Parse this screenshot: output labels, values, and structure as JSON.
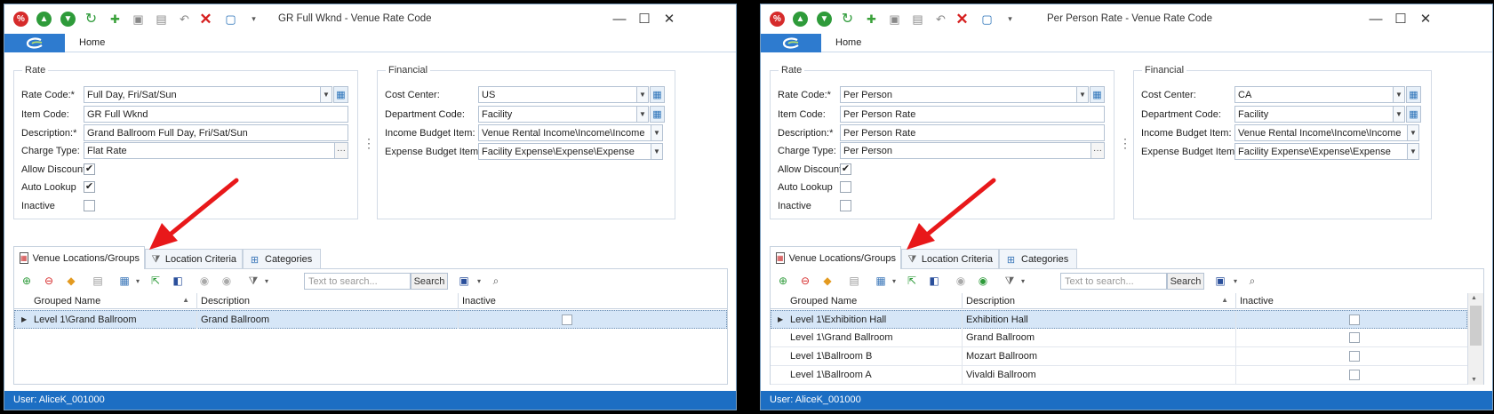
{
  "colors": {
    "accent": "#1c6ec3",
    "arrow": "#e8181a",
    "selected_row": "#d6e6f7"
  },
  "windows": [
    {
      "title": "GR Full Wknd - Venue Rate Code",
      "ribbon": {
        "home_tab": "Home"
      },
      "rate": {
        "group_title": "Rate",
        "rate_code_label": "Rate Code:*",
        "rate_code_value": "Full Day, Fri/Sat/Sun",
        "item_code_label": "Item Code:",
        "item_code_value": "GR Full Wknd",
        "description_label": "Description:*",
        "description_value": "Grand Ballroom Full Day, Fri/Sat/Sun",
        "charge_type_label": "Charge Type:",
        "charge_type_value": "Flat Rate",
        "allow_discount_label": "Allow Discount",
        "allow_discount_mark": "✔",
        "auto_lookup_label": "Auto Lookup",
        "auto_lookup_mark": "✔",
        "inactive_label": "Inactive",
        "inactive_mark": ""
      },
      "financial": {
        "group_title": "Financial",
        "cost_center_label": "Cost Center:",
        "cost_center_value": "US",
        "department_code_label": "Department Code:",
        "department_code_value": "Facility",
        "income_budget_item_label": "Income Budget Item:",
        "income_budget_item_value": "Venue Rental Income\\Income\\Income",
        "expense_budget_item_label": "Expense Budget Item:",
        "expense_budget_item_value": "Facility Expense\\Expense\\Expense"
      },
      "tabs": [
        {
          "label": "Venue Locations/Groups",
          "icon": "venue-icon",
          "active": true
        },
        {
          "label": "Location Criteria",
          "icon": "filter-icon",
          "active": false
        },
        {
          "label": "Categories",
          "icon": "hierarchy-icon",
          "active": false
        }
      ],
      "grid": {
        "search_placeholder": "Text to search...",
        "search_button": "Search",
        "columns": [
          "Grouped Name",
          "Description",
          "Inactive"
        ],
        "rows": [
          {
            "grouped_name": "Level 1\\Grand Ballroom",
            "description": "Grand Ballroom",
            "inactive": false
          }
        ]
      },
      "status": "User: AliceK_001000"
    },
    {
      "title": "Per Person Rate - Venue Rate Code",
      "ribbon": {
        "home_tab": "Home"
      },
      "rate": {
        "group_title": "Rate",
        "rate_code_label": "Rate Code:*",
        "rate_code_value": "Per Person",
        "item_code_label": "Item Code:",
        "item_code_value": "Per Person Rate",
        "description_label": "Description:*",
        "description_value": "Per Person Rate",
        "charge_type_label": "Charge Type:",
        "charge_type_value": "Per Person",
        "allow_discount_label": "Allow Discount",
        "allow_discount_mark": "✔",
        "auto_lookup_label": "Auto Lookup",
        "auto_lookup_mark": "",
        "inactive_label": "Inactive",
        "inactive_mark": ""
      },
      "financial": {
        "group_title": "Financial",
        "cost_center_label": "Cost Center:",
        "cost_center_value": "CA",
        "department_code_label": "Department Code:",
        "department_code_value": "Facility",
        "income_budget_item_label": "Income Budget Item:",
        "income_budget_item_value": "Venue Rental Income\\Income\\Income",
        "expense_budget_item_label": "Expense Budget Item:",
        "expense_budget_item_value": "Facility Expense\\Expense\\Expense"
      },
      "tabs": [
        {
          "label": "Venue Locations/Groups",
          "icon": "venue-icon",
          "active": true
        },
        {
          "label": "Location Criteria",
          "icon": "filter-icon",
          "active": false
        },
        {
          "label": "Categories",
          "icon": "hierarchy-icon",
          "active": false
        }
      ],
      "grid": {
        "search_placeholder": "Text to search...",
        "search_button": "Search",
        "columns": [
          "Grouped Name",
          "Description",
          "Inactive"
        ],
        "rows": [
          {
            "grouped_name": "Level 1\\Exhibition Hall",
            "description": "Exhibition Hall",
            "inactive": false
          },
          {
            "grouped_name": "Level 1\\Grand Ballroom",
            "description": "Grand Ballroom",
            "inactive": false
          },
          {
            "grouped_name": "Level 1\\Ballroom B",
            "description": "Mozart Ballroom",
            "inactive": false
          },
          {
            "grouped_name": "Level 1\\Ballroom A",
            "description": "Vivaldi Ballroom",
            "inactive": false
          }
        ]
      },
      "status": "User: AliceK_001000"
    }
  ]
}
